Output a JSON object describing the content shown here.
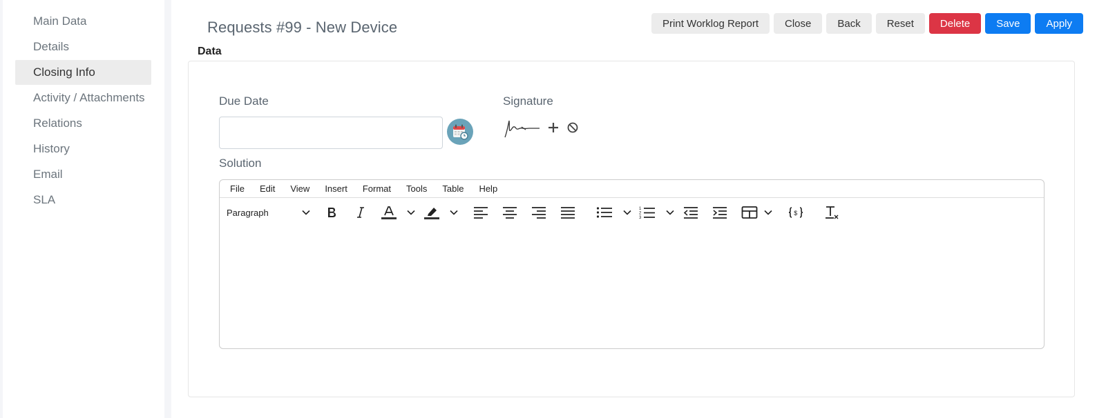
{
  "sidebar": {
    "items": [
      {
        "label": "Main Data"
      },
      {
        "label": "Details"
      },
      {
        "label": "Closing Info",
        "active": true
      },
      {
        "label": "Activity / Attachments"
      },
      {
        "label": "Relations"
      },
      {
        "label": "History"
      },
      {
        "label": "Email"
      },
      {
        "label": "SLA"
      }
    ]
  },
  "header": {
    "title": "Requests #99 - New Device",
    "buttons": {
      "print": "Print Worklog Report",
      "close": "Close",
      "back": "Back",
      "reset": "Reset",
      "delete": "Delete",
      "save": "Save",
      "apply": "Apply"
    }
  },
  "section": {
    "label": "Data"
  },
  "form": {
    "due_date": {
      "label": "Due Date",
      "value": ""
    },
    "signature": {
      "label": "Signature"
    },
    "solution": {
      "label": "Solution"
    }
  },
  "editor": {
    "menu": [
      "File",
      "Edit",
      "View",
      "Insert",
      "Format",
      "Tools",
      "Table",
      "Help"
    ],
    "block_format": "Paragraph",
    "icons": [
      "chevron-down-icon",
      "bold-icon",
      "italic-icon",
      "text-color-icon",
      "highlight-icon",
      "align-left-icon",
      "align-center-icon",
      "align-right-icon",
      "justify-icon",
      "bullet-list-icon",
      "numbered-list-icon",
      "outdent-icon",
      "indent-icon",
      "table-icon",
      "code-sample-icon",
      "clear-format-icon"
    ]
  },
  "colors": {
    "primary": "#0d7cf2",
    "danger": "#dc3545",
    "neutral_button": "#ececec",
    "calendar_bubble": "#6aa3b9"
  }
}
